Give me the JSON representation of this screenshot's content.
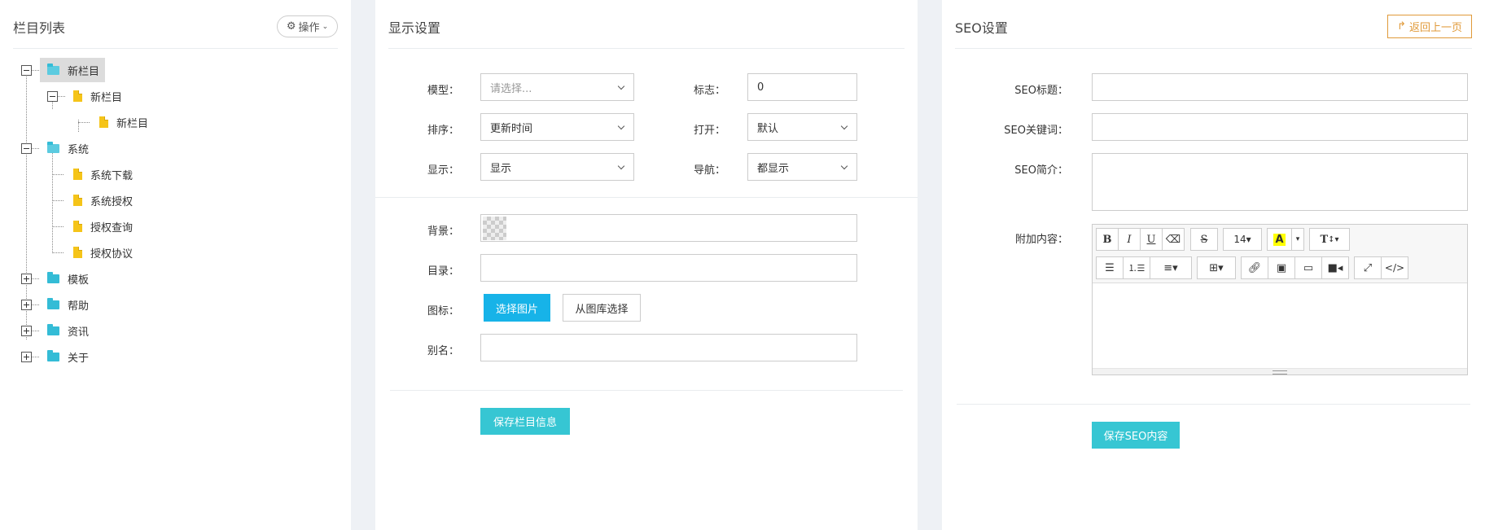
{
  "left": {
    "title": "栏目列表",
    "op_label": "操作",
    "tree": [
      {
        "label": "新栏目"
      },
      {
        "label": "新栏目"
      },
      {
        "label": "新栏目"
      },
      {
        "label": "系统"
      },
      {
        "label": "系统下载"
      },
      {
        "label": "系统授权"
      },
      {
        "label": "授权查询"
      },
      {
        "label": "授权协议"
      },
      {
        "label": "模板"
      },
      {
        "label": "帮助"
      },
      {
        "label": "资讯"
      },
      {
        "label": "关于"
      }
    ]
  },
  "display": {
    "title": "显示设置",
    "model_label": "模型：",
    "model_placeholder": "请选择...",
    "flag_label": "标志：",
    "flag_value": "0",
    "sort_label": "排序：",
    "sort_value": "更新时间",
    "open_label": "打开：",
    "open_value": "默认",
    "show_label": "显示：",
    "show_value": "显示",
    "nav_label": "导航：",
    "nav_value": "都显示",
    "bg_label": "背景：",
    "dir_label": "目录：",
    "dir_value": "",
    "icon_label": "图标：",
    "choose_img": "选择图片",
    "from_gallery": "从图库选择",
    "alias_label": "别名：",
    "alias_value": "",
    "save": "保存栏目信息"
  },
  "seo": {
    "title": "SEO设置",
    "back": "返回上一页",
    "seo_title_label": "SEO标题：",
    "seo_title_value": "",
    "seo_kw_label": "SEO关键词：",
    "seo_kw_value": "",
    "seo_desc_label": "SEO简介：",
    "seo_desc_value": "",
    "extra_label": "附加内容：",
    "font_size": "14",
    "save": "保存SEO内容"
  },
  "colors": {
    "accent_blue": "#17b3e8",
    "teal": "#36c6d3",
    "back_orange": "#e09a3a",
    "folder": "#34bcd6",
    "doc": "#f5c419"
  }
}
